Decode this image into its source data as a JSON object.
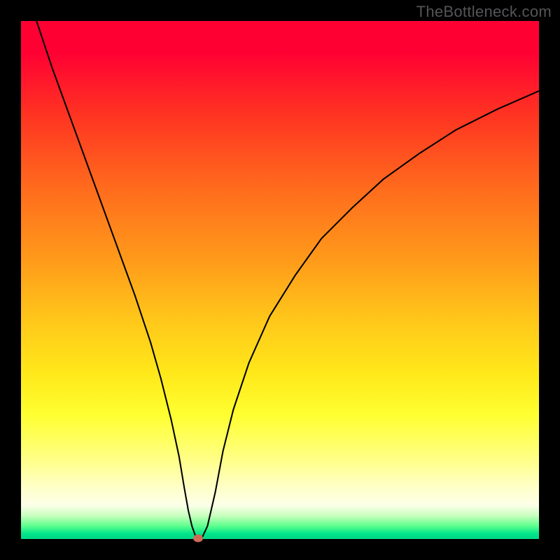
{
  "watermark": "TheBottleneck.com",
  "colors": {
    "frame": "#000000",
    "curve": "#000000",
    "marker": "#cf6a56",
    "gradient_top": "#ff0033",
    "gradient_bottom": "#00d586"
  },
  "chart_data": {
    "type": "line",
    "title": "",
    "xlabel": "",
    "ylabel": "",
    "xlim": [
      0,
      100
    ],
    "ylim": [
      0,
      100
    ],
    "grid": false,
    "legend": false,
    "series": [
      {
        "name": "bottleneck-curve",
        "x": [
          3,
          6,
          10,
          14,
          18,
          22,
          25,
          27,
          29,
          30.5,
          31.5,
          32.3,
          33,
          33.6,
          34.2,
          35,
          36,
          37.5,
          39,
          41,
          44,
          48,
          53,
          58,
          64,
          70,
          77,
          84,
          92,
          100
        ],
        "y": [
          100,
          91,
          80,
          69,
          58,
          47,
          38,
          31,
          23,
          16,
          10,
          5.5,
          2.5,
          0.8,
          0.2,
          0.35,
          2.5,
          9,
          17,
          25,
          34,
          43,
          51,
          58,
          64,
          69.5,
          74.5,
          79,
          83,
          86.5
        ]
      }
    ],
    "marker": {
      "x": 34.2,
      "y": 0.2
    },
    "background": "vertical-gradient red→orange→yellow→pale→green"
  }
}
